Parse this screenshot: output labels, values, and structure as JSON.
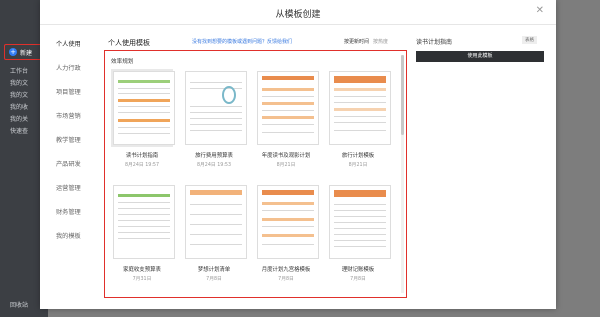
{
  "background": {
    "sidebar": {
      "new_label": "新建",
      "items": [
        "工作台",
        "我的文",
        "我的文",
        "我的收",
        "我的关",
        "快速查"
      ],
      "bottom_label": "回收站"
    }
  },
  "modal": {
    "title": "从模板创建",
    "close_glyph": "✕",
    "categories": [
      {
        "label": "个人使用",
        "active": true
      },
      {
        "label": "人力行政",
        "active": false
      },
      {
        "label": "项目管理",
        "active": false
      },
      {
        "label": "市场营销",
        "active": false
      },
      {
        "label": "教学管理",
        "active": false
      },
      {
        "label": "产品研发",
        "active": false
      },
      {
        "label": "运营管理",
        "active": false
      },
      {
        "label": "财务管理",
        "active": false
      },
      {
        "label": "我的模板",
        "active": false
      }
    ],
    "content": {
      "title": "个人使用模板",
      "link": "没有找到想要的模板或遇到问题？反馈给我们",
      "sort_time": "按更新时间",
      "sort_hot": "按热度",
      "section_label": "效率规划",
      "templates": [
        {
          "name": "读书计划指南",
          "date": "8月24日 19:57",
          "selected": true
        },
        {
          "name": "旅行费用预算表",
          "date": "8月24日 19:53",
          "selected": false
        },
        {
          "name": "年度读书及观影计划",
          "date": "8月21日",
          "selected": false
        },
        {
          "name": "旅行计划模板",
          "date": "8月21日",
          "selected": false
        },
        {
          "name": "家庭收支预算表",
          "date": "7月31日",
          "selected": false
        },
        {
          "name": "梦想计划清单",
          "date": "7月8日",
          "selected": false
        },
        {
          "name": "月度计划九宫格模板",
          "date": "7月8日",
          "selected": false
        },
        {
          "name": "理财记账模板",
          "date": "7月8日",
          "selected": false
        }
      ]
    },
    "preview": {
      "title": "读书计划指南",
      "tag": "表格",
      "use_button": "使用此模板"
    }
  }
}
